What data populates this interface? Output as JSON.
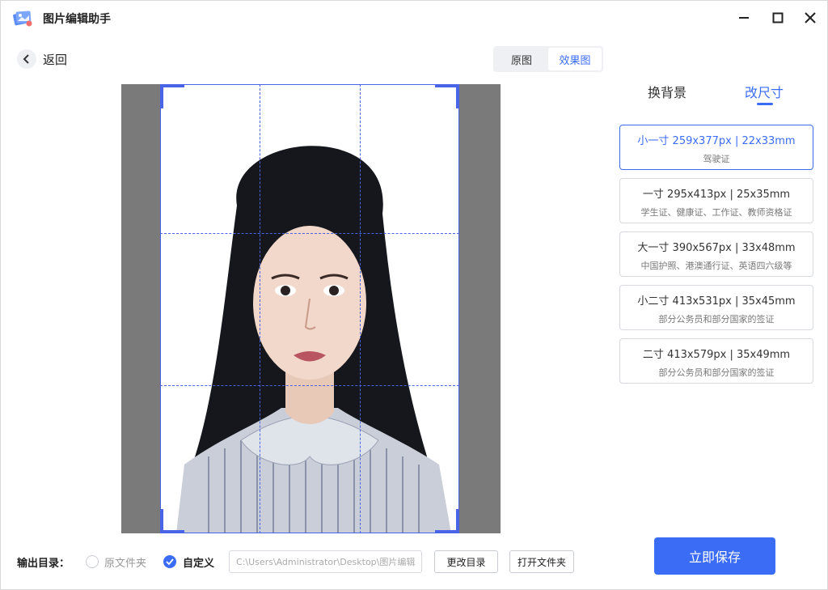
{
  "app": {
    "title": "图片编辑助手"
  },
  "nav": {
    "back_label": "返回"
  },
  "view_toggle": {
    "original_label": "原图",
    "effect_label": "效果图",
    "active": "effect"
  },
  "right_tabs": {
    "background_label": "换背景",
    "resize_label": "改尺寸",
    "active": "resize"
  },
  "sizes": [
    {
      "title": "小一寸 259x377px | 22x33mm",
      "sub": "驾驶证",
      "active": true
    },
    {
      "title": "一寸 295x413px | 25x35mm",
      "sub": "学生证、健康证、工作证、教师资格证",
      "active": false
    },
    {
      "title": "大一寸 390x567px | 33x48mm",
      "sub": "中国护照、港澳通行证、英语四六级等",
      "active": false
    },
    {
      "title": "小二寸 413x531px | 35x45mm",
      "sub": "部分公务员和部分国家的签证",
      "active": false
    },
    {
      "title": "二寸 413x579px | 35x49mm",
      "sub": "部分公务员和部分国家的签证",
      "active": false
    }
  ],
  "output": {
    "label": "输出目录：",
    "option_original": "原文件夹",
    "option_custom": "自定义",
    "selected": "custom",
    "path": "C:\\Users\\Administrator\\Desktop\\图片编辑",
    "change_button": "更改目录",
    "open_button": "打开文件夹"
  },
  "save_button": "立即保存",
  "colors": {
    "accent": "#3b6cf6",
    "crop_frame": "#4a64e8",
    "preview_bg": "#7a7a7a"
  }
}
